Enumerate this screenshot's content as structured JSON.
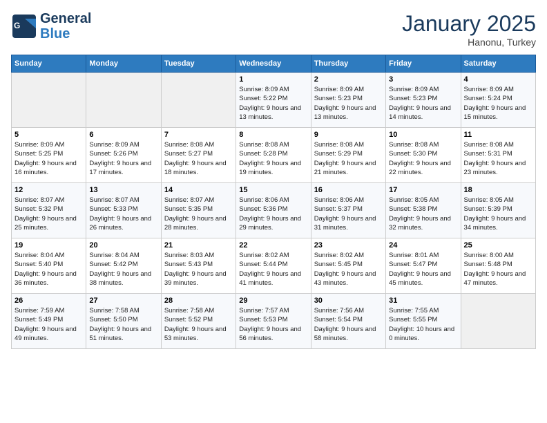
{
  "header": {
    "logo_general": "General",
    "logo_blue": "Blue",
    "month": "January 2025",
    "location": "Hanonu, Turkey"
  },
  "days_of_week": [
    "Sunday",
    "Monday",
    "Tuesday",
    "Wednesday",
    "Thursday",
    "Friday",
    "Saturday"
  ],
  "weeks": [
    [
      {
        "day": "",
        "empty": true
      },
      {
        "day": "",
        "empty": true
      },
      {
        "day": "",
        "empty": true
      },
      {
        "day": "1",
        "sunrise": "8:09 AM",
        "sunset": "5:22 PM",
        "daylight": "9 hours and 13 minutes."
      },
      {
        "day": "2",
        "sunrise": "8:09 AM",
        "sunset": "5:23 PM",
        "daylight": "9 hours and 13 minutes."
      },
      {
        "day": "3",
        "sunrise": "8:09 AM",
        "sunset": "5:23 PM",
        "daylight": "9 hours and 14 minutes."
      },
      {
        "day": "4",
        "sunrise": "8:09 AM",
        "sunset": "5:24 PM",
        "daylight": "9 hours and 15 minutes."
      }
    ],
    [
      {
        "day": "5",
        "sunrise": "8:09 AM",
        "sunset": "5:25 PM",
        "daylight": "9 hours and 16 minutes."
      },
      {
        "day": "6",
        "sunrise": "8:09 AM",
        "sunset": "5:26 PM",
        "daylight": "9 hours and 17 minutes."
      },
      {
        "day": "7",
        "sunrise": "8:08 AM",
        "sunset": "5:27 PM",
        "daylight": "9 hours and 18 minutes."
      },
      {
        "day": "8",
        "sunrise": "8:08 AM",
        "sunset": "5:28 PM",
        "daylight": "9 hours and 19 minutes."
      },
      {
        "day": "9",
        "sunrise": "8:08 AM",
        "sunset": "5:29 PM",
        "daylight": "9 hours and 21 minutes."
      },
      {
        "day": "10",
        "sunrise": "8:08 AM",
        "sunset": "5:30 PM",
        "daylight": "9 hours and 22 minutes."
      },
      {
        "day": "11",
        "sunrise": "8:08 AM",
        "sunset": "5:31 PM",
        "daylight": "9 hours and 23 minutes."
      }
    ],
    [
      {
        "day": "12",
        "sunrise": "8:07 AM",
        "sunset": "5:32 PM",
        "daylight": "9 hours and 25 minutes."
      },
      {
        "day": "13",
        "sunrise": "8:07 AM",
        "sunset": "5:33 PM",
        "daylight": "9 hours and 26 minutes."
      },
      {
        "day": "14",
        "sunrise": "8:07 AM",
        "sunset": "5:35 PM",
        "daylight": "9 hours and 28 minutes."
      },
      {
        "day": "15",
        "sunrise": "8:06 AM",
        "sunset": "5:36 PM",
        "daylight": "9 hours and 29 minutes."
      },
      {
        "day": "16",
        "sunrise": "8:06 AM",
        "sunset": "5:37 PM",
        "daylight": "9 hours and 31 minutes."
      },
      {
        "day": "17",
        "sunrise": "8:05 AM",
        "sunset": "5:38 PM",
        "daylight": "9 hours and 32 minutes."
      },
      {
        "day": "18",
        "sunrise": "8:05 AM",
        "sunset": "5:39 PM",
        "daylight": "9 hours and 34 minutes."
      }
    ],
    [
      {
        "day": "19",
        "sunrise": "8:04 AM",
        "sunset": "5:40 PM",
        "daylight": "9 hours and 36 minutes."
      },
      {
        "day": "20",
        "sunrise": "8:04 AM",
        "sunset": "5:42 PM",
        "daylight": "9 hours and 38 minutes."
      },
      {
        "day": "21",
        "sunrise": "8:03 AM",
        "sunset": "5:43 PM",
        "daylight": "9 hours and 39 minutes."
      },
      {
        "day": "22",
        "sunrise": "8:02 AM",
        "sunset": "5:44 PM",
        "daylight": "9 hours and 41 minutes."
      },
      {
        "day": "23",
        "sunrise": "8:02 AM",
        "sunset": "5:45 PM",
        "daylight": "9 hours and 43 minutes."
      },
      {
        "day": "24",
        "sunrise": "8:01 AM",
        "sunset": "5:47 PM",
        "daylight": "9 hours and 45 minutes."
      },
      {
        "day": "25",
        "sunrise": "8:00 AM",
        "sunset": "5:48 PM",
        "daylight": "9 hours and 47 minutes."
      }
    ],
    [
      {
        "day": "26",
        "sunrise": "7:59 AM",
        "sunset": "5:49 PM",
        "daylight": "9 hours and 49 minutes."
      },
      {
        "day": "27",
        "sunrise": "7:58 AM",
        "sunset": "5:50 PM",
        "daylight": "9 hours and 51 minutes."
      },
      {
        "day": "28",
        "sunrise": "7:58 AM",
        "sunset": "5:52 PM",
        "daylight": "9 hours and 53 minutes."
      },
      {
        "day": "29",
        "sunrise": "7:57 AM",
        "sunset": "5:53 PM",
        "daylight": "9 hours and 56 minutes."
      },
      {
        "day": "30",
        "sunrise": "7:56 AM",
        "sunset": "5:54 PM",
        "daylight": "9 hours and 58 minutes."
      },
      {
        "day": "31",
        "sunrise": "7:55 AM",
        "sunset": "5:55 PM",
        "daylight": "10 hours and 0 minutes."
      },
      {
        "day": "",
        "empty": true
      }
    ]
  ],
  "labels": {
    "sunrise": "Sunrise:",
    "sunset": "Sunset:",
    "daylight": "Daylight:"
  }
}
